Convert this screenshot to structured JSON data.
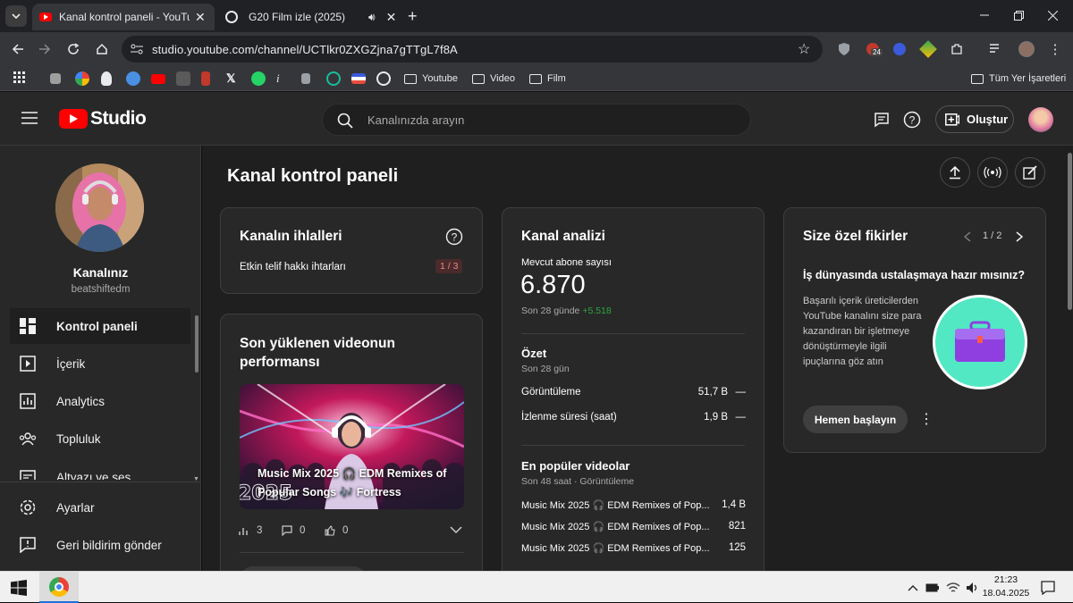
{
  "browser": {
    "tabs": [
      {
        "title": "Kanal kontrol paneli - YouTube"
      },
      {
        "title": "G20 Film izle (2025)"
      }
    ],
    "url": "studio.youtube.com/channel/UCTlkr0ZXGZjna7gTTgL7f8A",
    "bookmarks": [
      {
        "label": "Youtube"
      },
      {
        "label": "Video"
      },
      {
        "label": "Film"
      },
      {
        "label": "Tüm Yer İşaretleri"
      }
    ],
    "extension_badge": "24"
  },
  "header": {
    "logo_text": "Studio",
    "search_placeholder": "Kanalınızda arayın",
    "create_label": "Oluştur"
  },
  "sidebar": {
    "channel_heading": "Kanalınız",
    "channel_name": "beatshiftedm",
    "items": [
      {
        "label": "Kontrol paneli",
        "icon": "dashboard-icon"
      },
      {
        "label": "İçerik",
        "icon": "content-icon"
      },
      {
        "label": "Analytics",
        "icon": "analytics-icon"
      },
      {
        "label": "Topluluk",
        "icon": "community-icon"
      },
      {
        "label": "Altyazı ve ses",
        "icon": "subtitles-icon"
      }
    ],
    "bottom_items": [
      {
        "label": "Ayarlar",
        "icon": "gear-icon"
      },
      {
        "label": "Geri bildirim gönder",
        "icon": "feedback-icon"
      }
    ]
  },
  "main": {
    "page_title": "Kanal kontrol paneli",
    "violations": {
      "title": "Kanalın ihlalleri",
      "row_label": "Etkin telif hakkı ihtarları",
      "badge": "1 / 3"
    },
    "recent_video": {
      "title": "Son yüklenen videonun performansı",
      "thumb_title": "Music Mix 2025 🎧 EDM Remixes of Popular Songs 🎶 Fortress",
      "thumb_badge": "2025",
      "views": "3",
      "comments": "0",
      "likes": "0"
    },
    "analytics": {
      "title": "Kanal analizi",
      "subs_label": "Mevcut abone sayısı",
      "subs_value": "6.870",
      "subs_period": "Son 28 günde",
      "subs_change": "+5.518",
      "summary_title": "Özet",
      "summary_period": "Son 28 gün",
      "rows": [
        {
          "label": "Görüntüleme",
          "value": "51,7 B",
          "trend": "—"
        },
        {
          "label": "İzlenme süresi (saat)",
          "value": "1,9 B",
          "trend": "—"
        }
      ],
      "top_title": "En popüler videolar",
      "top_period": "Son 48 saat · Görüntüleme",
      "top_videos": [
        {
          "title": "Music Mix 2025 🎧 EDM Remixes of Pop...",
          "value": "1,4 B"
        },
        {
          "title": "Music Mix 2025 🎧 EDM Remixes of Pop...",
          "value": "821"
        },
        {
          "title": "Music Mix 2025 🎧 EDM Remixes of Pop...",
          "value": "125"
        }
      ]
    },
    "ideas": {
      "title": "Size özel fikirler",
      "pager": "1 / 2",
      "heading": "İş dünyasında ustalaşmaya hazır mısınız?",
      "body": "Başarılı içerik üreticilerden YouTube kanalını size para kazandıran bir işletmeye dönüştürmeyle ilgili ipuçlarına göz atın",
      "cta": "Hemen başlayın"
    }
  },
  "taskbar": {
    "time": "21:23",
    "date": "18.04.2025"
  },
  "colors": {
    "youtube_red": "#ff0000",
    "positive_green": "#2ba640",
    "badge_red": "#e88a8a",
    "ideas_circle": "#52e8c4",
    "briefcase": "#8f3fe0"
  }
}
